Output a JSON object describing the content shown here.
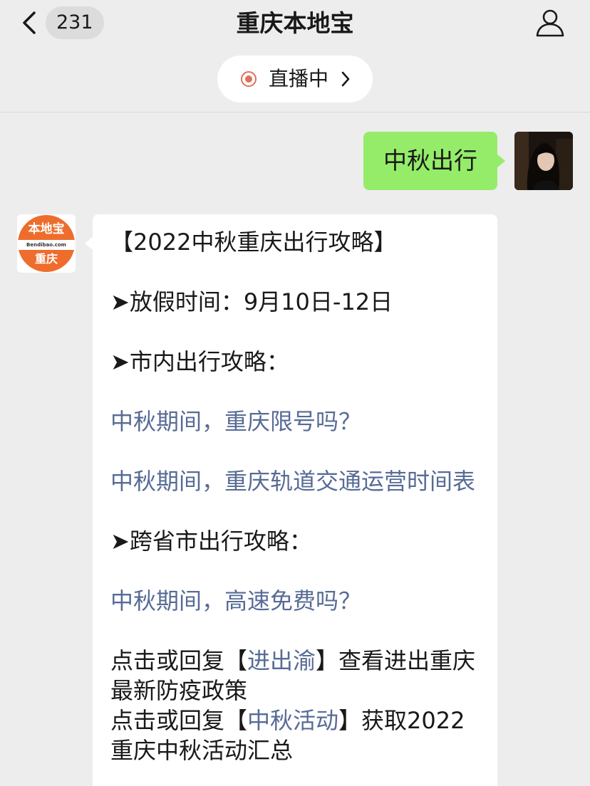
{
  "header": {
    "unread_count": "231",
    "title": "重庆本地宝",
    "live_label": "直播中"
  },
  "icons": {
    "back": "chevron-left-icon",
    "profile": "person-outline-icon",
    "live": "live-record-icon",
    "live_chevron": "chevron-right-icon"
  },
  "colors": {
    "background": "#ededed",
    "outgoing_bubble": "#95ec69",
    "incoming_bubble": "#ffffff",
    "link": "#576b95",
    "live_dot": "#e0705b",
    "logo_orange": "#ee6d2d"
  },
  "outgoing_message": {
    "text": "中秋出行"
  },
  "bot_avatar": {
    "logo_top": "本地宝",
    "logo_url": "Bendibao.com",
    "logo_city": "重庆"
  },
  "incoming_message": {
    "headline": "【2022中秋重庆出行攻略】",
    "holiday": "➤放假时间：9月10日-12日",
    "city_section": "➤市内出行攻略：",
    "link_restriction": "中秋期间，重庆限号吗？",
    "link_rail": "中秋期间，重庆轨道交通运营时间表",
    "intercity_section": "➤跨省市出行攻略：",
    "link_highway": "中秋期间，高速免费吗？",
    "line1_prefix": "点击或回复【",
    "line1_keyword": "进出渝",
    "line1_suffix": "】查看进出重庆最新防疫政策",
    "line2_prefix": "点击或回复【",
    "line2_keyword": "中秋活动",
    "line2_suffix": "】获取2022重庆中秋活动汇总"
  }
}
